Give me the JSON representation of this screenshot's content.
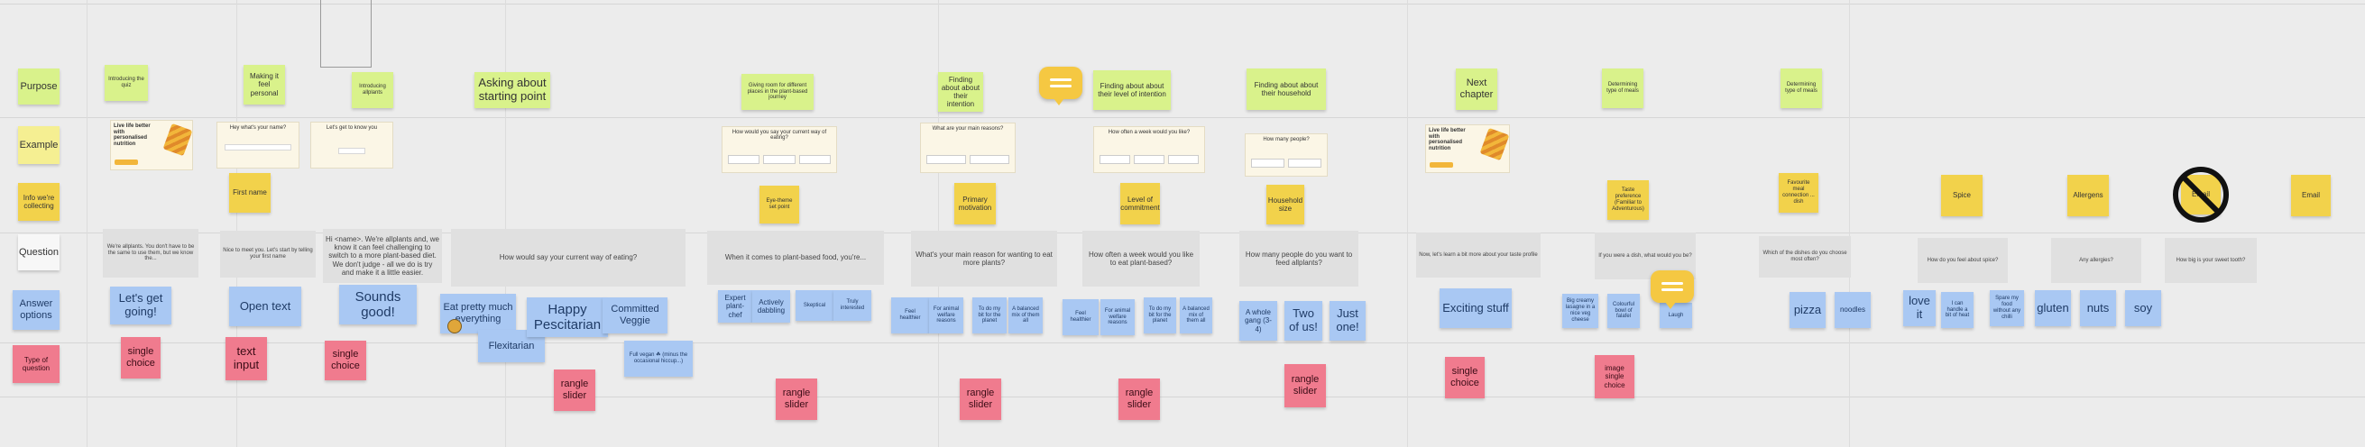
{
  "row_labels": {
    "purpose": "Purpose",
    "example": "Example",
    "info": "Info we're collecting",
    "question": "Question",
    "answers": "Answer options",
    "type": "Type of question"
  },
  "purposes": {
    "p1": "Introducing the quiz",
    "p2": "Making it feel personal",
    "p3": "Introducing allplants",
    "p4": "Asking about starting point",
    "p5": "Giving room for different places in the plant-based journey",
    "p6": "Finding about about their intention",
    "p7": "Finding about about their level of intention",
    "p8": "Finding about about their household",
    "p9": "Next chapter",
    "p10": "Determining type of meals",
    "p11": "Determining type of meals"
  },
  "examples": {
    "e1": "Live life better with personalised nutrition",
    "e2": "Hey what's your name?",
    "e3": "Let's get to know you",
    "e4": "How would you say your current way of eating?",
    "e5": "What are your main reasons?",
    "e6": "How often a week would you like?",
    "e7": "How many people?",
    "e8": "Live life better with personalised nutrition"
  },
  "info": {
    "i1": "First name",
    "i2": "Eye-theme set point",
    "i3": "Primary motivation",
    "i4": "Level of commitment",
    "i5": "Household size",
    "i6": "Taste preference (Familiar to Adventurous)",
    "i7": "Favourite meal connection ... dish",
    "i8": "Spice",
    "i9": "Allergens",
    "i10": "Email",
    "crossed": "Name"
  },
  "questions": {
    "q1": "We're allplants. You don't have to be the same to use them, but we know the...",
    "q2": "Nice to meet you. Let's start by telling your first name",
    "q3": "Hi <name>. We're allplants and, we know it can feel challenging to switch to a more plant-based diet. We don't judge - all we do is try and make it a little easier.",
    "q4": "How would say your current way of eating?",
    "q5": "When it comes to plant-based food, you're...",
    "q6": "What's your main reason for wanting to eat more plants?",
    "q7": "How often a week would you like to eat plant-based?",
    "q8": "How many people do you want to feed allplants?",
    "q9": "Now, let's learn a bit more about your taste profile",
    "q10": "If you were a dish, what would you be?",
    "q11": "Which of the dishes do you choose most often?",
    "q12": "How do you feel about spice?",
    "q13": "Any allergies?",
    "q14": "How big is your sweet tooth?"
  },
  "answers": {
    "a1": "Let's get going!",
    "a2": "Open text",
    "a3": "Sounds good!",
    "a4": "Eat pretty much everything",
    "a5": "Flexitarian",
    "a6": "Happy Pescitarian",
    "a7": "Committed Veggie",
    "a8": "Full vegan ☘ (minus the occasional hiccup...)",
    "a9": "Expert plant-chef",
    "a10": "Actively dabbling",
    "a11": "Skeptical",
    "a12": "Truly interested",
    "a13": "Feel healthier",
    "a14": "For animal welfare reasons",
    "a15": "To do my bit for the planet",
    "a16": "A balanced mix of them all",
    "a17": "Feel healthier",
    "a18": "For animal welfare reasons",
    "a19": "To do my bit for the planet",
    "a20": "A balanced mix of them all",
    "a21": "A whole gang (3-4)",
    "a22": "Two of us!",
    "a23": "Just one!",
    "a24": "Exciting stuff",
    "a25": "Big creamy lasagne in a nice veg cheese",
    "a26": "Colourful bowl of falafel",
    "a27": "Laugh",
    "a28": "pizza",
    "a29": "noodles",
    "a30": "love it",
    "a31": "I can handle a bit of heat",
    "a32": "Spare my food without any chilli",
    "a33": "gluten",
    "a34": "nuts",
    "a35": "soy"
  },
  "types": {
    "t1": "single choice",
    "t2": "text input",
    "t3": "single choice",
    "t4": "rangle slider",
    "t5": "rangle slider",
    "t6": "rangle slider",
    "t7": "rangle slider",
    "t8": "rangle slider",
    "t9": "single choice",
    "t10": "image single choice"
  },
  "colors": {
    "lime": "#d9f28b",
    "lemon": "#f5ef92",
    "gold": "#f2d24b",
    "blue": "#a9c8f3",
    "pink": "#f07b8e",
    "comment": "#f5c842"
  }
}
